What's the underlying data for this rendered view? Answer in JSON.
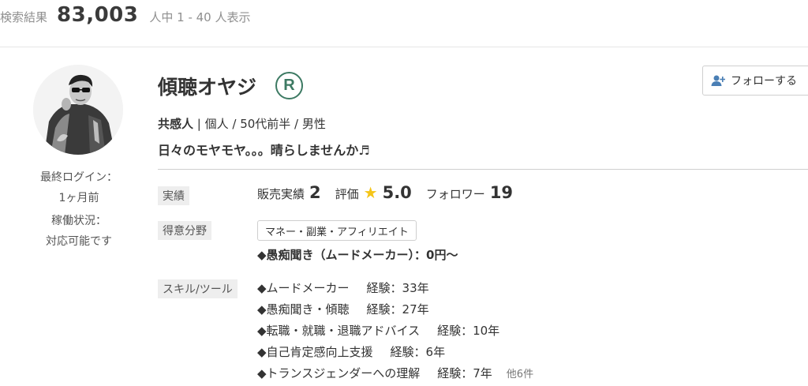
{
  "search": {
    "label": "検索結果",
    "count": "83,003",
    "range": "人中 1 - 40 人表示"
  },
  "profile": {
    "name": "傾聴オヤジ",
    "badge": "R",
    "follow_label": "フォローする",
    "attr_type": "共感人",
    "attr_rest": " | 個人 / 50代前半 / 男性",
    "catchphrase": "日々のモヤモヤ。。。晴らしませんか♬",
    "last_login_label": "最終ログイン：",
    "last_login_value": "1ヶ月前",
    "status_label": "稼働状況：",
    "status_value": "対応可能です"
  },
  "achievements": {
    "label": "実績",
    "sales_label": "販売実績",
    "sales_value": "2",
    "rating_label": "評価",
    "rating_value": "5.0",
    "followers_label": "フォロワー",
    "followers_value": "19"
  },
  "specialty": {
    "label": "得意分野",
    "tag": "マネー・副業・アフィリエイト",
    "item": "◆愚痴聞き（ムードメーカー）：0円〜"
  },
  "skills": {
    "label": "スキル/ツール",
    "items": [
      {
        "name": "◆ムードメーカー",
        "experience": "経験：33年"
      },
      {
        "name": "◆愚痴聞き・傾聴",
        "experience": "経験：27年"
      },
      {
        "name": "◆転職・就職・退職アドバイス",
        "experience": "経験：10年"
      },
      {
        "name": "◆自己肯定感向上支援",
        "experience": "経験：6年"
      },
      {
        "name": "◆トランスジェンダーへの理解",
        "experience": "経験：7年"
      }
    ],
    "more": "他6件"
  },
  "icons": {
    "rating": "star-icon",
    "follow": "add-user-icon",
    "badge": "registered-badge-icon"
  },
  "colors": {
    "badge": "#3d7a63",
    "star": "#f5c518",
    "chip_bg": "#eeeeee"
  }
}
